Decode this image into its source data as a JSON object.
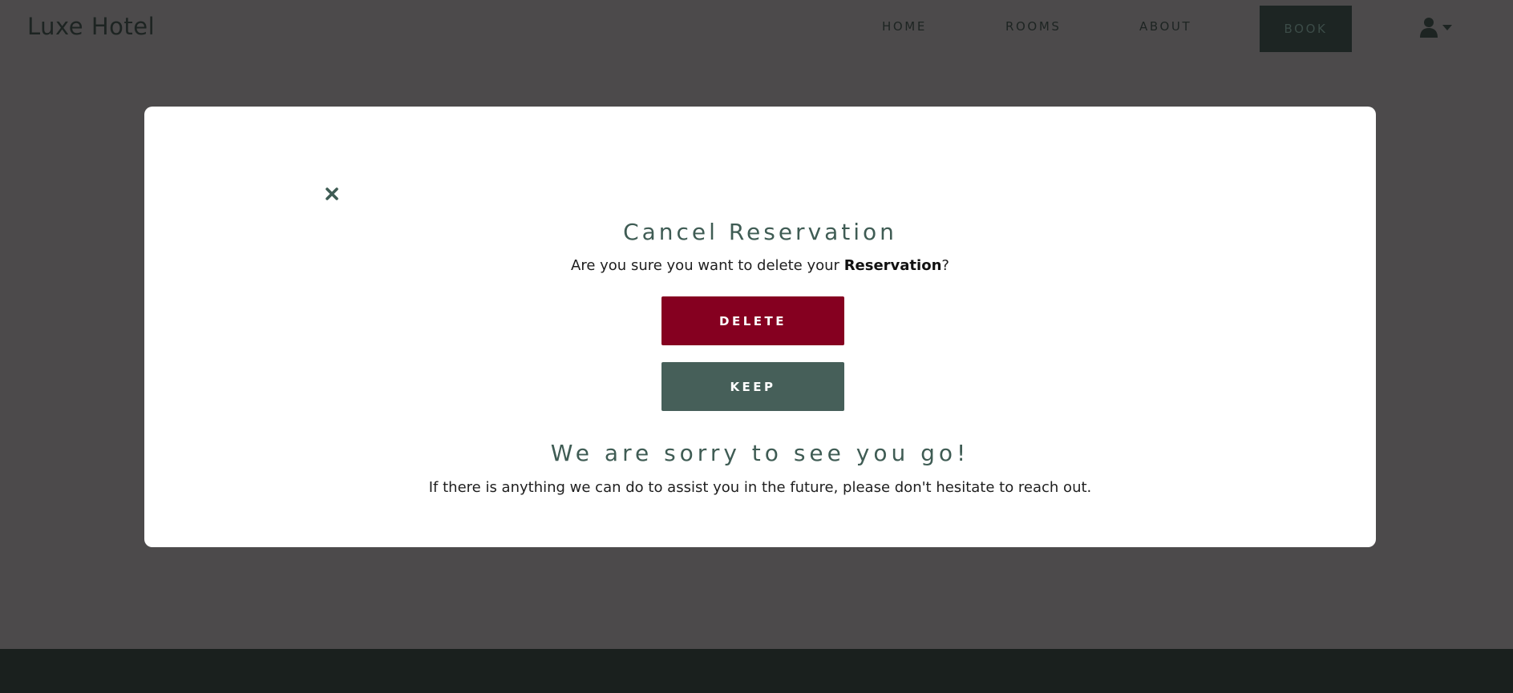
{
  "header": {
    "brand": "Luxe Hotel",
    "nav": {
      "home": "HOME",
      "rooms": "ROOMS",
      "about": "ABOUT",
      "book": "BOOK"
    },
    "user_icon": "user-icon",
    "caret_icon": "caret-down-icon"
  },
  "modal": {
    "close_icon": "close-icon",
    "title": "Cancel Reservation",
    "question_prefix": "Are you sure you want to delete your ",
    "question_emphasis": "Reservation",
    "question_suffix": "?",
    "delete_label": "DELETE",
    "keep_label": "KEEP",
    "sorry_title": "We are sorry to see you go!",
    "sorry_text": "If there is anything we can do to assist you in the future, please don't hesitate to reach out."
  },
  "colors": {
    "overlay": "#4c4a4b",
    "accent_green": "#3f5c54",
    "delete_red": "#850020",
    "keep_green": "#465f59",
    "footer": "#1a201e"
  }
}
